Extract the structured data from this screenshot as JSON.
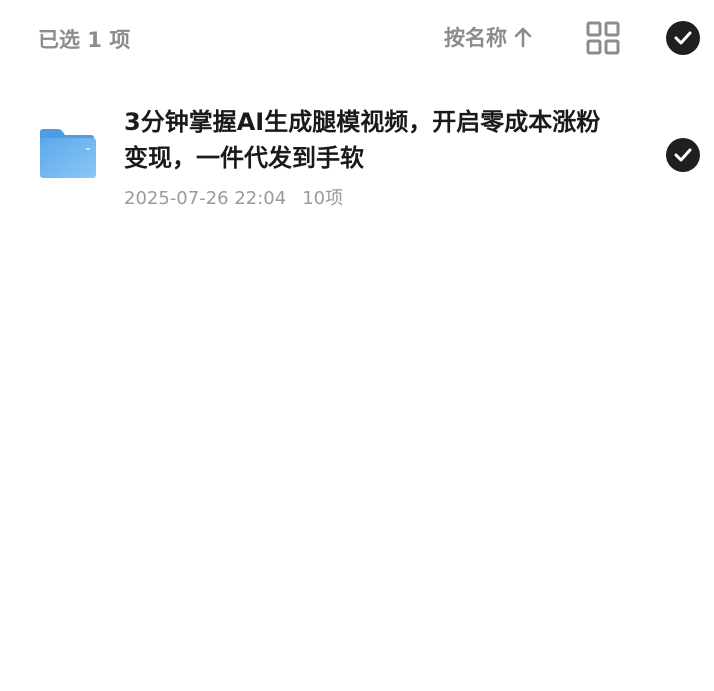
{
  "toolbar": {
    "selected_label": "已选 1 项",
    "sort_label": "按名称",
    "sort_icon": "arrow-up-icon",
    "view_icon": "grid-icon",
    "select_all_icon": "check-circle-icon"
  },
  "files": [
    {
      "icon": "folder-icon",
      "name": "3分钟掌握AI生成腿模视频，开启零成本涨粉变现，一件代发到手软",
      "date": "2025-07-26 22:04",
      "count": "10项",
      "selected": true
    }
  ],
  "colors": {
    "folder": "#5aa9ec",
    "check_bg": "#1f1f1f",
    "muted_text": "#8c8c8c"
  }
}
